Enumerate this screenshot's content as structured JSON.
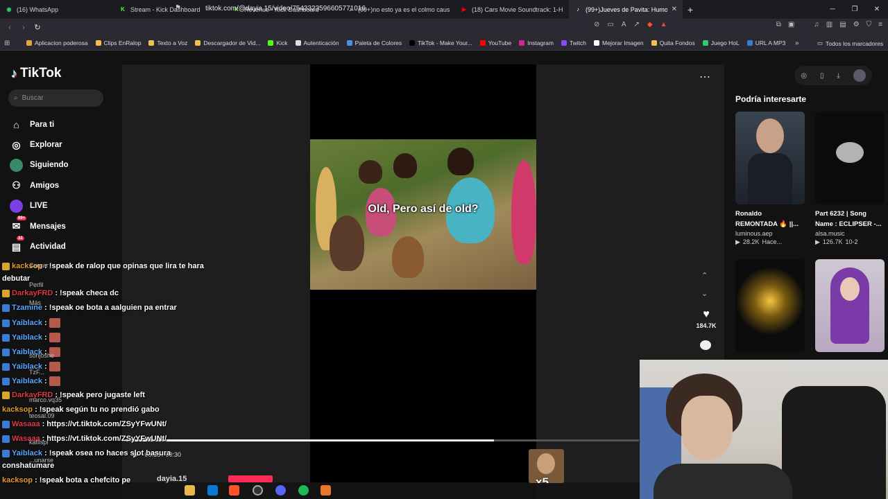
{
  "browser": {
    "tabs": [
      {
        "label": "(16) WhatsApp",
        "color": "#25d366",
        "glyph": "◉"
      },
      {
        "label": "Stream - Kick Dashboard",
        "color": "#53fc18",
        "glyph": "K"
      },
      {
        "label": "Revenue - Kick Dashboard",
        "color": "#53fc18",
        "glyph": "K"
      },
      {
        "label": "(99+)no esto ya es el colmo causa | e",
        "color": "#000000",
        "glyph": "♪"
      },
      {
        "label": "(18) Cars Movie Soundtrack: 1-H",
        "color": "#ff0000",
        "glyph": "▶"
      },
      {
        "label": "(99+)Jueves de Pavita: Humor Cl",
        "color": "#000000",
        "glyph": "♪",
        "active": true
      }
    ],
    "new_tab": "+",
    "url": "tiktok.com/@dayia.15/video/7543323596605771016",
    "bookmarks": [
      {
        "label": "Aplicacion poderosa",
        "color": "#e6a23c"
      },
      {
        "label": "Clips EnRalop",
        "color": "#f0c14b"
      },
      {
        "label": "Texto a Voz",
        "color": "#f0c14b"
      },
      {
        "label": "Descargador de Vid...",
        "color": "#f0c14b"
      },
      {
        "label": "Kick",
        "color": "#53fc18"
      },
      {
        "label": "Autenticación",
        "color": "#dddddd"
      },
      {
        "label": "Paleta de Colores",
        "color": "#4a90e2"
      },
      {
        "label": "TikTok - Make Your...",
        "color": "#000000"
      },
      {
        "label": "YouTube",
        "color": "#ff0000"
      },
      {
        "label": "Instagram",
        "color": "#d6249f"
      },
      {
        "label": "Twitch",
        "color": "#9146ff"
      },
      {
        "label": "Mejorar Imagen",
        "color": "#ffffff"
      },
      {
        "label": "Quita Fondos",
        "color": "#f0c14b"
      },
      {
        "label": "Juego HoL",
        "color": "#2ecc71"
      },
      {
        "label": "URL A MP3",
        "color": "#3a7bd5"
      }
    ],
    "bookmarks_more": "»",
    "all_bookmarks": "Todos los marcadores"
  },
  "tiktok": {
    "logo": "TikTok",
    "search_placeholder": "Buscar",
    "nav": [
      {
        "label": "Para ti",
        "icon": "home-icon",
        "glyph": "⌂"
      },
      {
        "label": "Explorar",
        "icon": "compass-icon",
        "glyph": "◎"
      },
      {
        "label": "Siguiendo",
        "icon": "following-avatar-icon",
        "glyph": "●"
      },
      {
        "label": "Amigos",
        "icon": "friends-icon",
        "glyph": "⚇"
      },
      {
        "label": "LIVE",
        "icon": "live-icon",
        "glyph": "●"
      },
      {
        "label": "Mensajes",
        "icon": "messages-icon",
        "glyph": "✉",
        "badge": "99+"
      },
      {
        "label": "Actividad",
        "icon": "activity-icon",
        "glyph": "▤",
        "badge": "32"
      }
    ],
    "ghost_nav": [
      "Cargar",
      "Perfil",
      "Más"
    ],
    "video_caption": "Old, Pero así de old?",
    "likes": "184.7K",
    "time": "00:18 / 00:30",
    "progress_fraction": 0.72,
    "author": "dayia.15",
    "suggest_title": "Podría interesarte",
    "suggestions": [
      {
        "title": "Ronaldo\nREMONTADA 🔥 ||...",
        "author": "luminous.aep",
        "views": "28.2K",
        "date": "Hace..."
      },
      {
        "title": "Part 6232 | Song\nName : ECLIPSER -...",
        "author": "alsa.music",
        "views": "126.7K",
        "date": "10-2"
      }
    ]
  },
  "chat": {
    "messages": [
      {
        "user": "kacksop",
        "text": ": !speak de ralop que opinas que lira te hara",
        "cont": "debutar",
        "color": "o",
        "badge": "y"
      },
      {
        "user": "DarkayFRD",
        "text": ": !speak checa dc",
        "color": "r",
        "badge": "y"
      },
      {
        "user": "Tzamine",
        "text": ": !speak oe bota a aalguien pa entrar",
        "color": "b",
        "badge": "b"
      },
      {
        "user": "Yaiblack",
        "text": " :",
        "color": "b",
        "badge": "b",
        "emote": true
      },
      {
        "user": "Yaiblack",
        "text": " :",
        "color": "b",
        "badge": "b",
        "emote": true
      },
      {
        "user": "Yaiblack",
        "text": " :",
        "color": "b",
        "badge": "b",
        "emote": true
      },
      {
        "user": "Yaiblack",
        "text": " :",
        "color": "b",
        "badge": "b",
        "emote": true
      },
      {
        "user": "Yaiblack",
        "text": " :",
        "color": "b",
        "badge": "b",
        "emote": true
      },
      {
        "user": "DarkayFRD",
        "text": ": !speak pero jugaste left",
        "color": "r",
        "badge": "y"
      },
      {
        "user": "kacksop",
        "text": ": !speak según tu no prendió gabo",
        "color": "o",
        "badge": "none"
      },
      {
        "user": "Wasaaa",
        "text": ": https://vt.tiktok.com/ZSyYFwUNt/",
        "color": "r",
        "badge": "b"
      },
      {
        "user": "Wasaaa",
        "text": ": https://vt.tiktok.com/ZSyYFwUNt/",
        "color": "r",
        "badge": "b"
      },
      {
        "user": "Yaiblack",
        "text": ": !speak osea no haces slot basura",
        "cont": "conshatumare",
        "color": "b",
        "badge": "b"
      },
      {
        "user": "kacksop",
        "text": ": !speak bota a chefcito pe",
        "color": "o",
        "badge": "none"
      },
      {
        "user": "Wasaaa",
        "text": ": https://vt.tiktok.com/ZSyYFwUNt/",
        "color": "r",
        "badge": "b"
      }
    ],
    "ghost_names": [
      "sonjoshe",
      "TzF...",
      "marco.vq35",
      "teosal.09",
      "katlispi",
      "...unarse"
    ]
  },
  "overlay": {
    "multiplier": "x5"
  }
}
